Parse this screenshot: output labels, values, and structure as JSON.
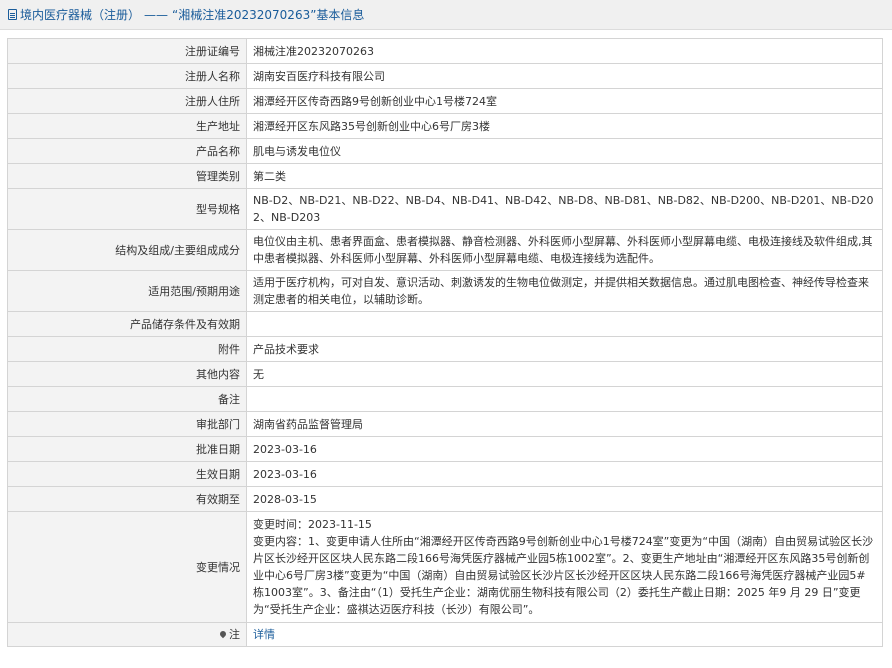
{
  "header": {
    "category": "境内医疗器械（注册）",
    "separator": "——",
    "title": "“湘械注准20232070263”基本信息"
  },
  "rows": [
    {
      "label": "注册证编号",
      "value": "湘械注准20232070263"
    },
    {
      "label": "注册人名称",
      "value": "湖南安百医疗科技有限公司"
    },
    {
      "label": "注册人住所",
      "value": "湘潭经开区传奇西路9号创新创业中心1号楼724室"
    },
    {
      "label": "生产地址",
      "value": "湘潭经开区东风路35号创新创业中心6号厂房3楼"
    },
    {
      "label": "产品名称",
      "value": "肌电与诱发电位仪"
    },
    {
      "label": "管理类别",
      "value": "第二类"
    },
    {
      "label": "型号规格",
      "value": "NB-D2、NB-D21、NB-D22、NB-D4、NB-D41、NB-D42、NB-D8、NB-D81、NB-D82、NB-D200、NB-D201、NB-D202、NB-D203"
    },
    {
      "label": "结构及组成/主要组成成分",
      "value": "电位仪由主机、患者界面盒、患者模拟器、静音检测器、外科医师小型屏幕、外科医师小型屏幕电缆、电极连接线及软件组成,其中患者模拟器、外科医师小型屏幕、外科医师小型屏幕电缆、电极连接线为选配件。"
    },
    {
      "label": "适用范围/预期用途",
      "value": "适用于医疗机构，可对自发、意识活动、刺激诱发的生物电位做测定，并提供相关数据信息。通过肌电图检查、神经传导检查来测定患者的相关电位，以辅助诊断。"
    },
    {
      "label": "产品储存条件及有效期",
      "value": ""
    },
    {
      "label": "附件",
      "value": "产品技术要求"
    },
    {
      "label": "其他内容",
      "value": "无"
    },
    {
      "label": "备注",
      "value": ""
    },
    {
      "label": "审批部门",
      "value": "湖南省药品监督管理局"
    },
    {
      "label": "批准日期",
      "value": "2023-03-16"
    },
    {
      "label": "生效日期",
      "value": "2023-03-16"
    },
    {
      "label": "有效期至",
      "value": "2028-03-15"
    }
  ],
  "change": {
    "label": "变更情况",
    "time": "变更时间：2023-11-15",
    "content": "变更内容：1、变更申请人住所由“湘潭经开区传奇西路9号创新创业中心1号楼724室”变更为“中国（湖南）自由贸易试验区长沙片区长沙经开区区块人民东路二段166号海凭医疗器械产业园5栋1002室”。2、变更生产地址由“湘潭经开区东风路35号创新创业中心6号厂房3楼”变更为“中国（湖南）自由贸易试验区长沙片区长沙经开区区块人民东路二段166号海凭医疗器械产业园5#栋1003室”。3、备注由“（1）受托生产企业：湖南优丽生物科技有限公司（2）委托生产截止日期：2025 年9 月 29 日”变更为“受托生产企业：盛祺达迈医疗科技（长沙）有限公司”。"
  },
  "note": {
    "label": "注",
    "icon": "pin-icon",
    "link": "详情"
  },
  "colors": {
    "link": "#1a5c9a",
    "label_bg": "#f3f3f3",
    "header_bg": "#f0f0f0",
    "border": "#d4d4d4"
  }
}
